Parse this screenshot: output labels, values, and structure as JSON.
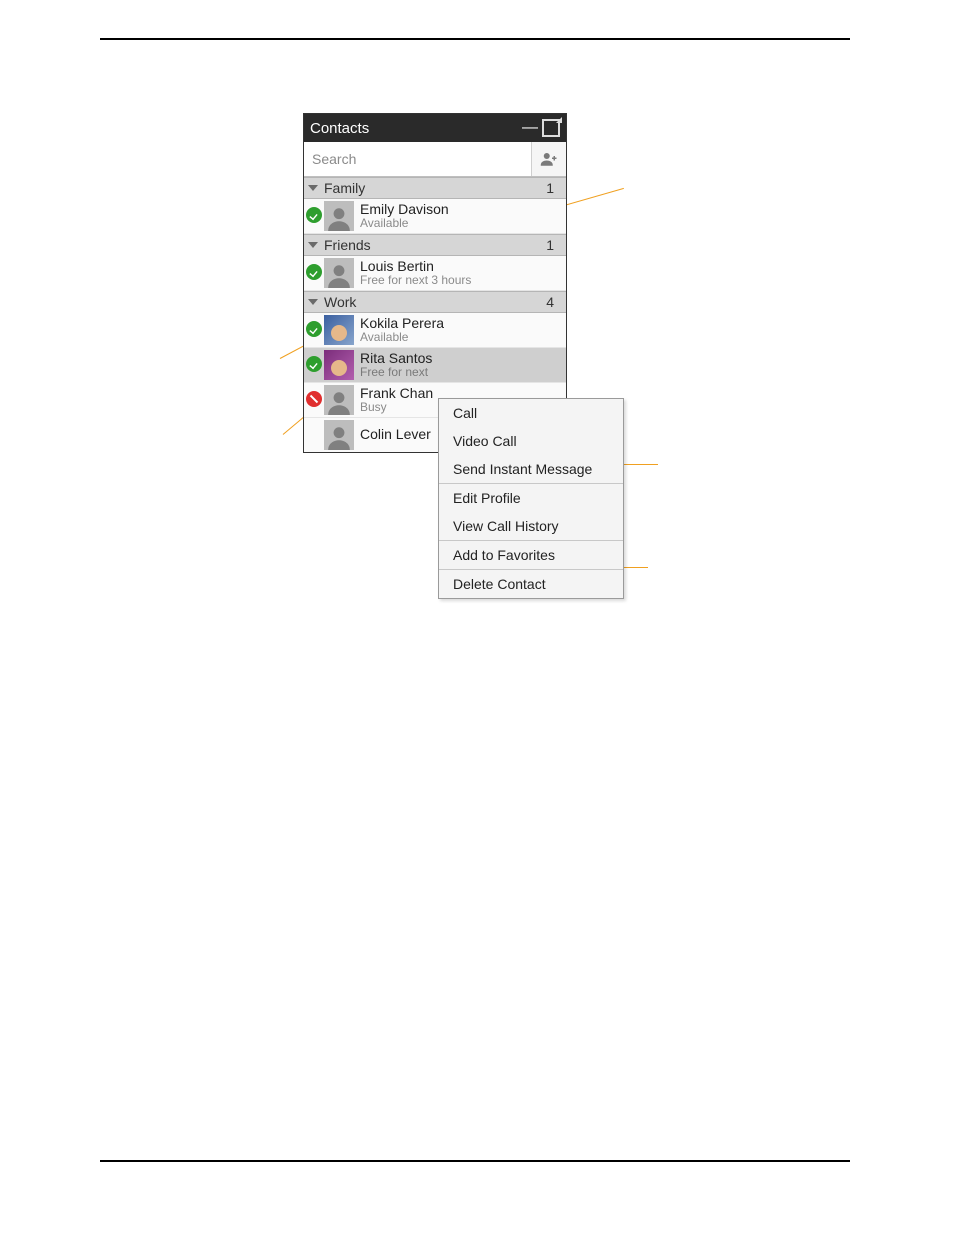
{
  "panel": {
    "title": "Contacts",
    "search_placeholder": "Search"
  },
  "groups": [
    {
      "name": "Family",
      "count": 1
    },
    {
      "name": "Friends",
      "count": 1
    },
    {
      "name": "Work",
      "count": 4
    }
  ],
  "contacts": {
    "emily": {
      "name": "Emily Davison",
      "status": "Available"
    },
    "louis": {
      "name": "Louis Bertin",
      "status": "Free for next 3 hours"
    },
    "kokila": {
      "name": "Kokila Perera",
      "status": "Available"
    },
    "rita": {
      "name": "Rita Santos",
      "status": "Free for next"
    },
    "frank": {
      "name": "Frank Chan",
      "status": "Busy"
    },
    "colin": {
      "name": "Colin Lever",
      "status": ""
    }
  },
  "menu": {
    "call": "Call",
    "video_call": "Video Call",
    "send_im": "Send Instant Message",
    "edit_profile": "Edit Profile",
    "view_history": "View Call History",
    "add_fav": "Add to Favorites",
    "delete": "Delete Contact"
  }
}
